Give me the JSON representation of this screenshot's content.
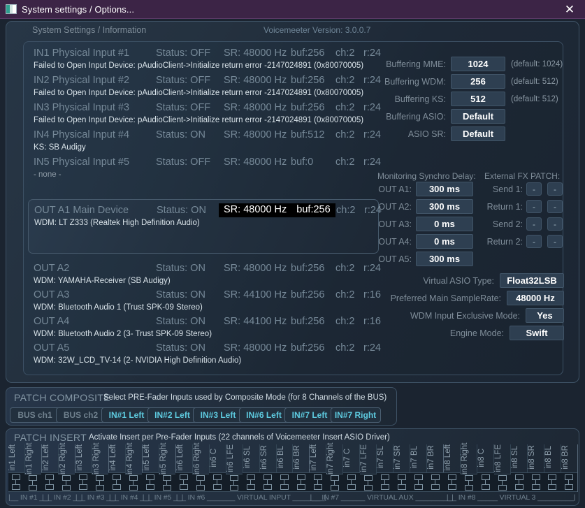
{
  "window": {
    "title": "System settings / Options...",
    "close_label": "✕",
    "icon": "app-window-icon"
  },
  "header": {
    "left_label": "System Settings / Information",
    "version": "Voicemeeter Version: 3.0.0.7"
  },
  "devices": [
    {
      "name": "IN1 Physical Input #1",
      "status": "Status: OFF",
      "sr": "SR: 48000 Hz",
      "buf": "buf:256",
      "ch": "ch:2",
      "r": "r:24",
      "sub": "Failed to Open Input Device: pAudioClient->Initialize return error -2147024891 (0x80070005)",
      "sub_kind": "err"
    },
    {
      "name": "IN2 Physical Input #2",
      "status": "Status: OFF",
      "sr": "SR: 48000 Hz",
      "buf": "buf:256",
      "ch": "ch:2",
      "r": "r:24",
      "sub": "Failed to Open Input Device: pAudioClient->Initialize return error -2147024891 (0x80070005)",
      "sub_kind": "err"
    },
    {
      "name": "IN3 Physical Input #3",
      "status": "Status: OFF",
      "sr": "SR: 48000 Hz",
      "buf": "buf:256",
      "ch": "ch:2",
      "r": "r:24",
      "sub": "Failed to Open Input Device: pAudioClient->Initialize return error -2147024891 (0x80070005)",
      "sub_kind": "err"
    },
    {
      "name": "IN4 Physical Input #4",
      "status": "Status: ON",
      "sr": "SR: 48000 Hz",
      "buf": "buf:512",
      "ch": "ch:2",
      "r": "r:24",
      "sub": "KS: SB Audigy",
      "sub_kind": "err"
    },
    {
      "name": "IN5 Physical Input #5",
      "status": "Status: OFF",
      "sr": "SR: 48000 Hz",
      "buf": "buf:0",
      "ch": "ch:2",
      "r": "r:24",
      "sub": "- none -",
      "sub_kind": "dim"
    }
  ],
  "selected_device": {
    "name": "OUT A1 Main Device",
    "status": "Status: ON",
    "sr": "SR: 48000 Hz",
    "buf": "buf:256",
    "ch": "ch:2",
    "r": "r:24",
    "sub": "WDM: LT Z333 (Realtek High Definition Audio)"
  },
  "outputs": [
    {
      "name": "OUT A2",
      "status": "Status: ON",
      "sr": "SR: 48000 Hz",
      "buf": "buf:256",
      "ch": "ch:2",
      "r": "r:24",
      "sub": "WDM: YAMAHA-Receiver (SB Audigy)"
    },
    {
      "name": "OUT A3",
      "status": "Status: ON",
      "sr": "SR: 44100 Hz",
      "buf": "buf:256",
      "ch": "ch:2",
      "r": "r:16",
      "sub": "WDM: Bluetooth Audio 1 (Trust SPK-09 Stereo)"
    },
    {
      "name": "OUT A4",
      "status": "Status: ON",
      "sr": "SR: 44100 Hz",
      "buf": "buf:256",
      "ch": "ch:2",
      "r": "r:16",
      "sub": "WDM: Bluetooth Audio 2 (3- Trust SPK-09 Stereo)"
    },
    {
      "name": "OUT A5",
      "status": "Status: ON",
      "sr": "SR: 48000 Hz",
      "buf": "buf:256",
      "ch": "ch:2",
      "r": "r:24",
      "sub": "WDM: 32W_LCD_TV-14 (2- NVIDIA High Definition Audio)"
    }
  ],
  "buffering": [
    {
      "label": "Buffering MME:",
      "value": "1024",
      "note": "(default: 1024)"
    },
    {
      "label": "Buffering WDM:",
      "value": "256",
      "note": "(default: 512)"
    },
    {
      "label": "Buffering KS:",
      "value": "512",
      "note": "(default: 512)"
    },
    {
      "label": "Buffering ASIO:",
      "value": "Default",
      "note": ""
    },
    {
      "label": "ASIO SR:",
      "value": "Default",
      "note": ""
    }
  ],
  "synchro": {
    "title": "Monitoring Synchro Delay:",
    "rows": [
      {
        "label": "OUT A1:",
        "value": "300 ms"
      },
      {
        "label": "OUT A2:",
        "value": "300 ms"
      },
      {
        "label": "OUT A3:",
        "value": "0 ms"
      },
      {
        "label": "OUT A4:",
        "value": "0 ms"
      },
      {
        "label": "OUT A5:",
        "value": "300 ms"
      }
    ]
  },
  "fxpatch": {
    "title": "External FX PATCH:",
    "rows": [
      {
        "label": "Send 1:",
        "a": "-",
        "b": "-"
      },
      {
        "label": "Return 1:",
        "a": "-",
        "b": "-"
      },
      {
        "label": "Send 2:",
        "a": "-",
        "b": "-"
      },
      {
        "label": "Return 2:",
        "a": "-",
        "b": "-"
      }
    ]
  },
  "options": [
    {
      "label": "Virtual ASIO Type:",
      "value": "Float32LSB"
    },
    {
      "label": "Preferred Main SampleRate:",
      "value": "48000 Hz"
    },
    {
      "label": "WDM Input Exclusive Mode:",
      "value": "Yes"
    },
    {
      "label": "Engine Mode:",
      "value": "Swift"
    }
  ],
  "composite": {
    "title": "PATCH COMPOSITE",
    "desc": "Select PRE-Fader Inputs used by Composite Mode (for 8 Channels of the BUS)",
    "buttons": [
      {
        "label": "BUS ch1",
        "active": false
      },
      {
        "label": "BUS ch2",
        "active": false
      },
      {
        "label": "IN#1 Left",
        "active": true
      },
      {
        "label": "IN#2 Left",
        "active": true
      },
      {
        "label": "IN#3 Left",
        "active": true
      },
      {
        "label": "IN#6 Left",
        "active": true
      },
      {
        "label": "IN#7 Left",
        "active": true
      },
      {
        "label": "IN#7 Right",
        "active": true
      }
    ]
  },
  "insert": {
    "title": "PATCH INSERT",
    "desc": "Activate Insert per Pre-Fader Inputs (22 channels of Voicemeeter Insert ASIO Driver)",
    "channels": [
      {
        "label": "in1 Left",
        "group_end": false
      },
      {
        "label": "in1 Right",
        "group_end": true
      },
      {
        "label": "in2 Left",
        "group_end": false
      },
      {
        "label": "in2 Right",
        "group_end": true
      },
      {
        "label": "in3 Left",
        "group_end": false
      },
      {
        "label": "in3 Right",
        "group_end": true
      },
      {
        "label": "in4 Left",
        "group_end": false
      },
      {
        "label": "in4 Right",
        "group_end": true
      },
      {
        "label": "in5 Left",
        "group_end": false
      },
      {
        "label": "in5 Right",
        "group_end": true
      },
      {
        "label": "in6 Left",
        "group_end": false
      },
      {
        "label": "in6 Right",
        "group_end": false
      },
      {
        "label": "in6 C",
        "group_end": false
      },
      {
        "label": "in6 LFE",
        "group_end": false
      },
      {
        "label": "in6 SL",
        "group_end": false
      },
      {
        "label": "in6 SR",
        "group_end": false
      },
      {
        "label": "in6 BL",
        "group_end": false
      },
      {
        "label": "in6 BR",
        "group_end": true
      },
      {
        "label": "in7 Left",
        "group_end": false
      },
      {
        "label": "in7 Right",
        "group_end": false
      },
      {
        "label": "in7 C",
        "group_end": false
      },
      {
        "label": "in7 LFE",
        "group_end": false
      },
      {
        "label": "in7 SL",
        "group_end": false
      },
      {
        "label": "in7 SR",
        "group_end": false
      },
      {
        "label": "in7 BL",
        "group_end": false
      },
      {
        "label": "in7 BR",
        "group_end": true
      },
      {
        "label": "in8 Left",
        "group_end": false
      },
      {
        "label": "in8 Right",
        "group_end": false
      },
      {
        "label": "in8 C",
        "group_end": false
      },
      {
        "label": "in8 LFE",
        "group_end": false
      },
      {
        "label": "in8 SL",
        "group_end": false
      },
      {
        "label": "in8 SR",
        "group_end": false
      },
      {
        "label": "in8 BL",
        "group_end": false
      },
      {
        "label": "in8 BR",
        "group_end": true
      }
    ],
    "footer_groups": [
      {
        "label": "|__ IN #1 __|",
        "start": 0,
        "span": 2
      },
      {
        "label": "|__ IN #2 __|",
        "start": 2,
        "span": 2
      },
      {
        "label": "|__ IN #3 __|",
        "start": 4,
        "span": 2
      },
      {
        "label": "|__ IN #4 __|",
        "start": 6,
        "span": 2
      },
      {
        "label": "|__ IN #5 __|",
        "start": 8,
        "span": 2
      },
      {
        "label": "|__ IN #6 _______ VIRTUAL INPUT ________|",
        "start": 10,
        "span": 8
      },
      {
        "label": "|__ IN #7 ______ VIRTUAL AUX _________|",
        "start": 18,
        "span": 8
      },
      {
        "label": "|__ IN #8 _____   VIRTUAL 3  _________|",
        "start": 26,
        "span": 8
      }
    ]
  },
  "colors": {
    "titlebar": "#3c2446",
    "accent_cyan": "#5ecbe0",
    "panel_bg": "#222f3e",
    "label_grey": "#7f8d99",
    "value_white": "#ffffff"
  }
}
